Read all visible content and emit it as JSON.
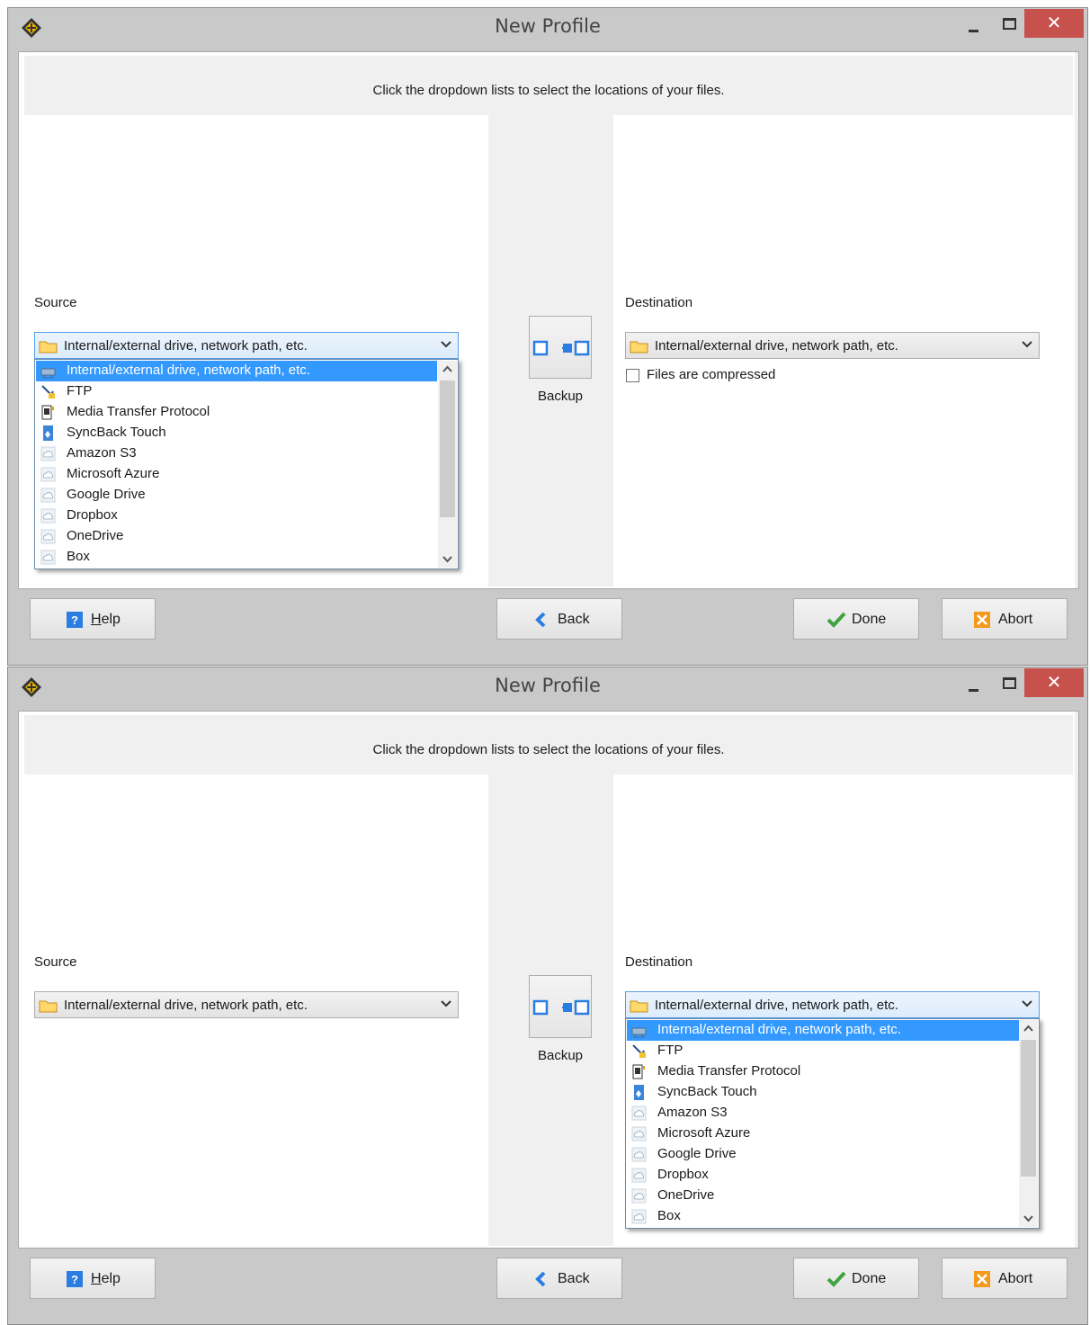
{
  "windows": [
    {
      "title": "New Profile",
      "close_glyph": "✕",
      "instruction": "Click the dropdown lists to select the locations of your files.",
      "source": {
        "label": "Source",
        "value": "Internal/external drive, network path, etc.",
        "open": true
      },
      "destination": {
        "label": "Destination",
        "value": "Internal/external drive, network path, etc.",
        "open": false,
        "compressed_label": "Files are compressed",
        "compressed_checked": false
      },
      "mode": {
        "label": "Backup"
      },
      "buttons": {
        "help": "Help",
        "help_mnemonic": "H",
        "help_rest": "elp",
        "back": "Back",
        "done": "Done",
        "abort": "Abort"
      }
    },
    {
      "title": "New Profile",
      "close_glyph": "✕",
      "instruction": "Click the dropdown lists to select the locations of your files.",
      "source": {
        "label": "Source",
        "value": "Internal/external drive, network path, etc.",
        "open": false
      },
      "destination": {
        "label": "Destination",
        "value": "Internal/external drive, network path, etc.",
        "open": true
      },
      "mode": {
        "label": "Backup"
      },
      "buttons": {
        "help": "Help",
        "help_mnemonic": "H",
        "help_rest": "elp",
        "back": "Back",
        "done": "Done",
        "abort": "Abort"
      }
    }
  ],
  "location_options": [
    {
      "label": "Internal/external drive, network path, etc.",
      "icon": "network-drive-icon"
    },
    {
      "label": "FTP",
      "icon": "ftp-icon"
    },
    {
      "label": "Media Transfer Protocol",
      "icon": "mtp-device-icon"
    },
    {
      "label": "SyncBack Touch",
      "icon": "syncback-touch-icon"
    },
    {
      "label": "Amazon S3",
      "icon": "cloud-icon"
    },
    {
      "label": "Microsoft Azure",
      "icon": "cloud-icon"
    },
    {
      "label": "Google Drive",
      "icon": "cloud-icon"
    },
    {
      "label": "Dropbox",
      "icon": "cloud-icon"
    },
    {
      "label": "OneDrive",
      "icon": "cloud-icon"
    },
    {
      "label": "Box",
      "icon": "cloud-icon"
    }
  ],
  "colors": {
    "selection": "#3399ff",
    "close_button": "#c7514c",
    "dialog_gray": "#f0f0f0"
  }
}
